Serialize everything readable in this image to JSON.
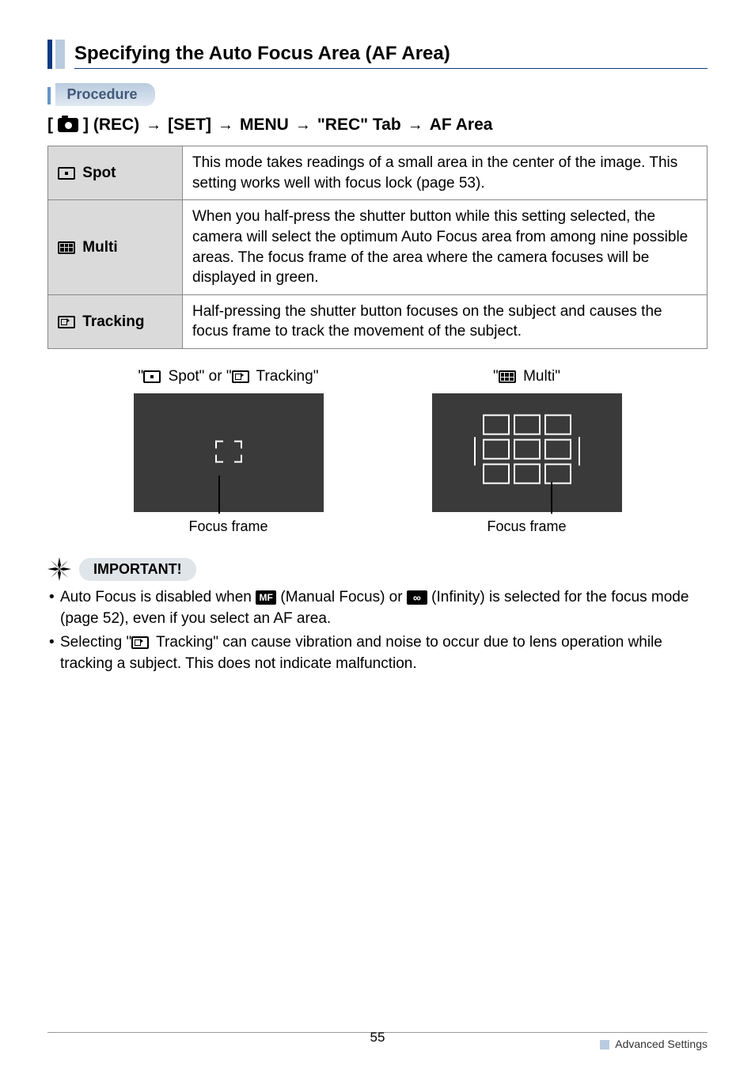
{
  "section_title": "Specifying the Auto Focus Area (AF Area)",
  "procedure_label": "Procedure",
  "breadcrumb": {
    "prefix": "[",
    "rec": "] (REC)",
    "set": "[SET]",
    "menu": "MENU",
    "tab": "\"REC\" Tab",
    "af": "AF Area"
  },
  "table": {
    "spot": {
      "label": "Spot",
      "desc": "This mode takes readings of a small area in the center of the image. This setting works well with focus lock (page 53)."
    },
    "multi": {
      "label": "Multi",
      "desc": "When you half-press the shutter button while this setting selected, the camera will select the optimum Auto Focus area from among nine possible areas. The focus frame of the area where the camera focuses will be displayed in green."
    },
    "tracking": {
      "label": "Tracking",
      "desc": "Half-pressing the shutter button focuses on the subject and causes the focus frame to track the movement of the subject."
    }
  },
  "vf": {
    "left_prefix": "\"",
    "left_spot": " Spot\" or \"",
    "left_track": " Tracking\"",
    "right_prefix": "\"",
    "right_multi": " Multi\"",
    "caption": "Focus frame"
  },
  "important": {
    "label": "IMPORTANT!",
    "b1a": "Auto Focus is disabled when ",
    "b1_mf": "MF",
    "b1b": " (Manual Focus) or ",
    "b1_inf": "∞",
    "b1c": " (Infinity) is selected for the focus mode (page 52), even if you select an AF area.",
    "b2a": "Selecting \"",
    "b2b": " Tracking\" can cause vibration and noise to occur due to lens operation while tracking a subject. This does not indicate malfunction."
  },
  "footer": {
    "page": "55",
    "section": "Advanced Settings"
  }
}
